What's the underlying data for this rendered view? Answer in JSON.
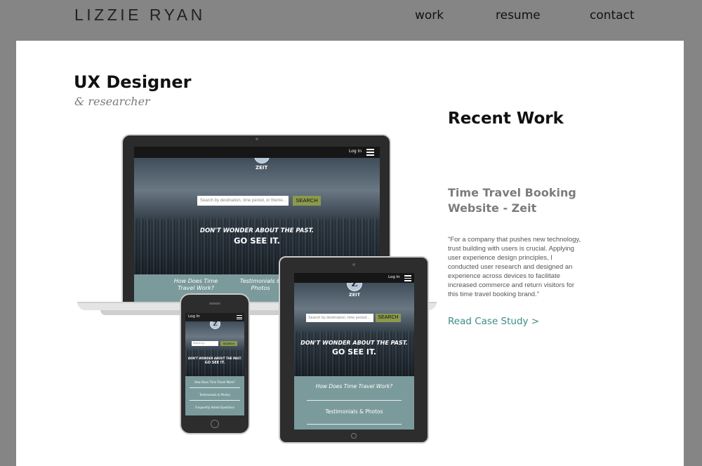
{
  "header": {
    "brand": "LIZZIE RYAN",
    "nav": {
      "work": "work",
      "resume": "resume",
      "contact": "contact"
    }
  },
  "intro": {
    "title": "UX Designer",
    "subtitle": "& researcher"
  },
  "recent_work": {
    "heading": "Recent Work",
    "project_title": "Time Travel Booking Website - Zeit",
    "description": "\"For a company that pushes new technology, trust building with users is crucial. Applying user experience design principles, I conducted user research and designed an experience across devices to facilitate increased commerce and return visitors for this time travel booking brand.\"",
    "link": "Read Case Study >"
  },
  "mockup": {
    "login": "Log In",
    "brand": "ZEIT",
    "logo_letter": "Z",
    "search_placeholder_full": "Search by destination, time period, or theme...",
    "search_placeholder_short": "Search by destination, time period...",
    "search_placeholder_phone": "Search by...",
    "search_button": "SEARCH",
    "tagline_1": "DON'T WONDER ABOUT THE PAST.",
    "tagline_2": "GO SEE IT.",
    "links": {
      "how": "How Does Time Travel Work?",
      "testimonials": "Testimonials & Photos",
      "faq": "Frequently Asked Questions"
    },
    "laptop_links": {
      "how": "How Does Time Travel Work?",
      "testimonials": "Testimonials & Photos"
    }
  }
}
